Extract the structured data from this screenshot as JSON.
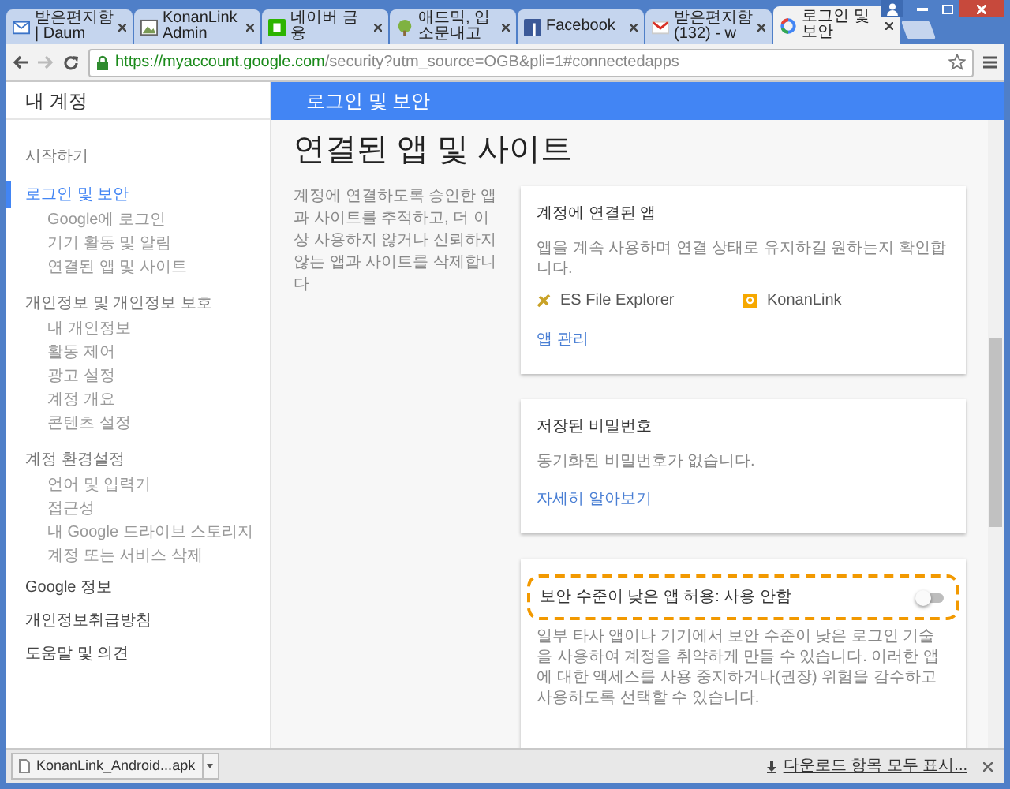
{
  "tabs": [
    {
      "title": "받은편지함 | Daum",
      "selected": false
    },
    {
      "title": "KonanLink Admin",
      "selected": false
    },
    {
      "title": "네이버 금융",
      "selected": false
    },
    {
      "title": "애드믹, 입소문내고",
      "selected": false
    },
    {
      "title": "Facebook",
      "selected": false
    },
    {
      "title": "받은편지함 (132) - w",
      "selected": false
    },
    {
      "title": "로그인 및 보안",
      "selected": true
    }
  ],
  "address_bar": {
    "origin": "https://myaccount.google.com",
    "path": "/security?utm_source=OGB&pli=1#connectedapps"
  },
  "sidebar": {
    "title": "내 계정",
    "items": [
      {
        "label": "시작하기",
        "kind": "section",
        "selected": false
      },
      {
        "label": "로그인 및 보안",
        "kind": "section",
        "selected": true,
        "children": [
          {
            "label": "Google에 로그인"
          },
          {
            "label": "기기 활동 및 알림"
          },
          {
            "label": "연결된 앱 및 사이트"
          }
        ]
      },
      {
        "label": "개인정보 및 개인정보 보호",
        "kind": "section",
        "selected": false,
        "children": [
          {
            "label": "내 개인정보"
          },
          {
            "label": "활동 제어"
          },
          {
            "label": "광고 설정"
          },
          {
            "label": "계정 개요"
          },
          {
            "label": "콘텐츠 설정"
          }
        ]
      },
      {
        "label": "계정 환경설정",
        "kind": "section",
        "selected": false,
        "children": [
          {
            "label": "언어 및 입력기"
          },
          {
            "label": "접근성"
          },
          {
            "label": "내 Google 드라이브 스토리지"
          },
          {
            "label": "계정 또는 서비스 삭제"
          }
        ]
      },
      {
        "label": "Google 정보",
        "kind": "link",
        "selected": false
      },
      {
        "label": "개인정보취급방침",
        "kind": "link",
        "selected": false
      },
      {
        "label": "도움말 및 의견",
        "kind": "link",
        "selected": false
      }
    ]
  },
  "header": {
    "title": "로그인 및 보안"
  },
  "page": {
    "title": "연결된 앱 및 사이트",
    "description": "계정에 연결하도록 승인한 앱과 사이트를 추적하고, 더 이상 사용하지 않거나 신뢰하지 않는 앱과 사이트를 삭제합니다"
  },
  "cards": [
    {
      "kind": "apps",
      "title": "계정에 연결된 앱",
      "text": "앱을 계속 사용하며 연결 상태로 유지하길 원하는지 확인합니다.",
      "apps": [
        "ES File Explorer",
        "KonanLink"
      ],
      "link": "앱 관리"
    },
    {
      "kind": "passwords",
      "title": "저장된 비밀번호",
      "text": "동기화된 비밀번호가 없습니다.",
      "link": "자세히 알아보기"
    },
    {
      "kind": "setting",
      "title": "보안 수준이 낮은 앱 허용: 사용 안함",
      "on": false,
      "highlighted": true,
      "text": "일부 타사 앱이나 기기에서 보안 수준이 낮은 로그인 기술을 사용하여 계정을 취약하게 만들 수 있습니다. 이러한 앱에 대한 액세스를 사용 중지하거나(권장) 위험을 감수하고 사용하도록 선택할 수 있습니다."
    }
  ],
  "downloads": {
    "file": "KonanLink_Android...apk",
    "show_all": "다운로드 항목 모두 표시..."
  }
}
